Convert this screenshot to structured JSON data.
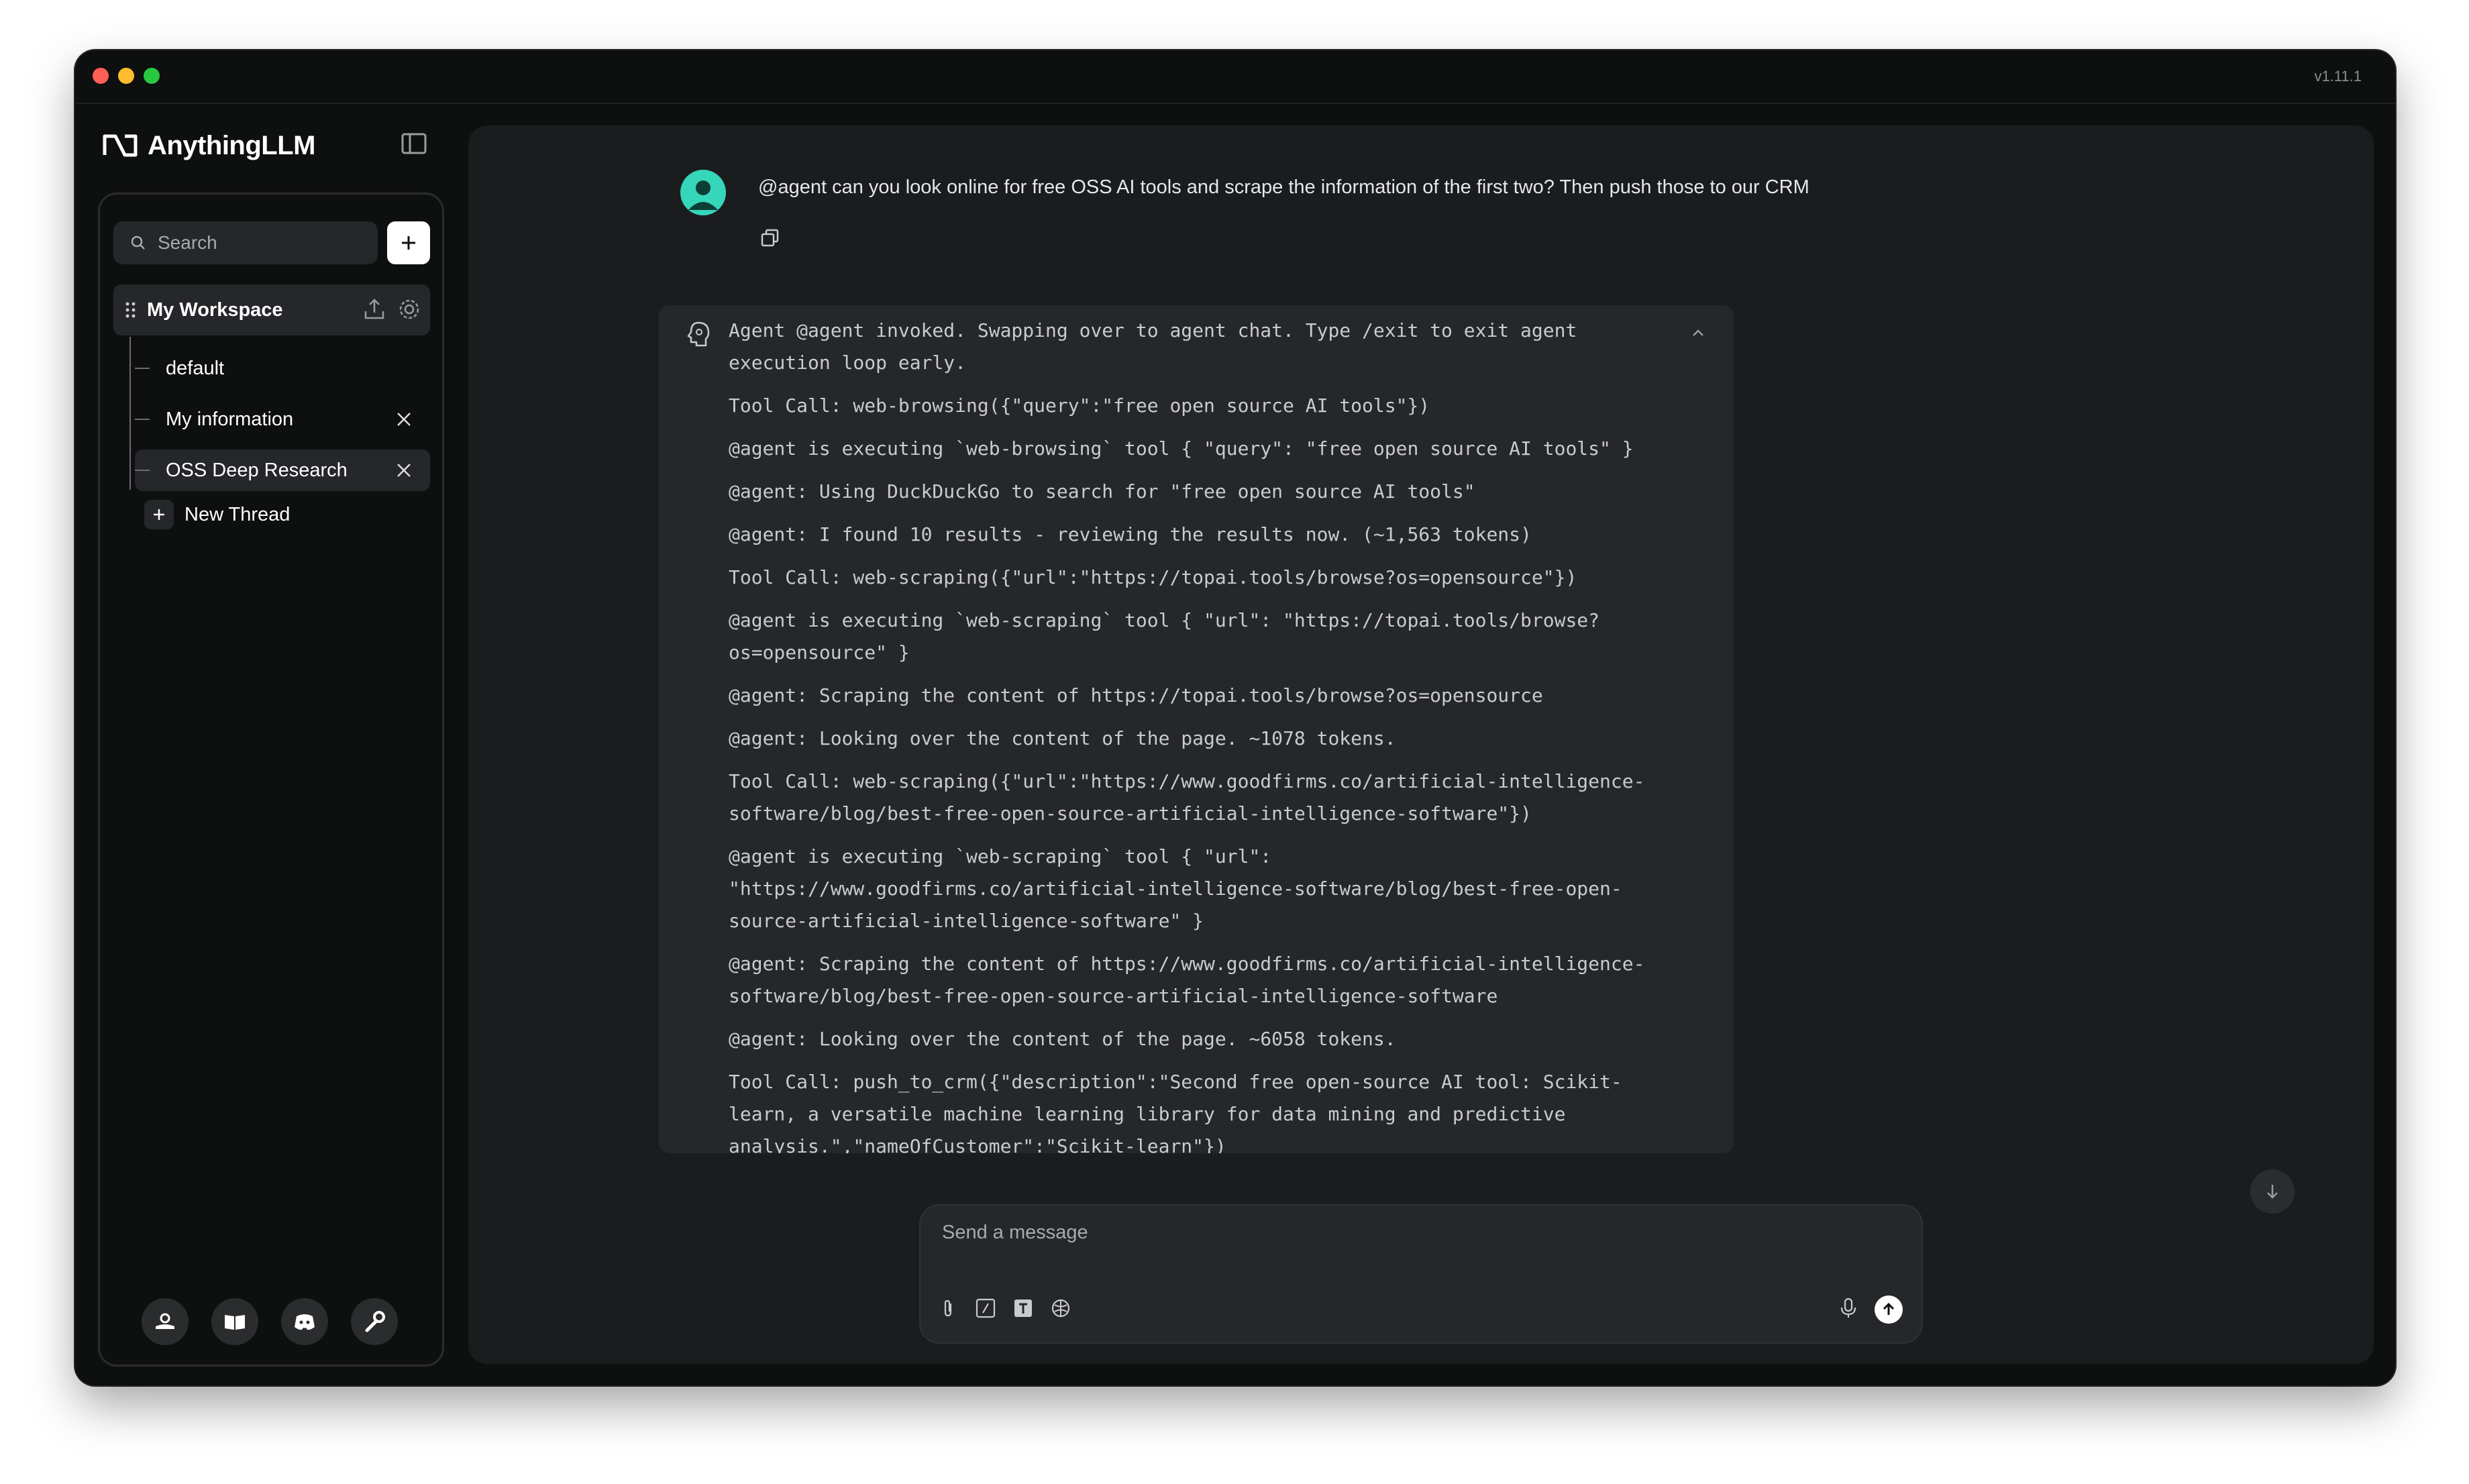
{
  "window": {
    "version": "v1.11.1"
  },
  "brand": {
    "name": "AnythingLLM"
  },
  "sidebar": {
    "search_placeholder": "Search",
    "workspace": {
      "name": "My Workspace"
    },
    "threads": [
      {
        "label": "default",
        "active": false,
        "closable": false
      },
      {
        "label": "My information",
        "active": false,
        "closable": true
      },
      {
        "label": "OSS Deep Research",
        "active": true,
        "closable": true
      }
    ],
    "new_thread_label": "New Thread",
    "footer_icons": [
      "community-hub-icon",
      "docs-book-icon",
      "discord-icon",
      "settings-wrench-icon"
    ]
  },
  "chat": {
    "user_message": "@agent can you look online for free OSS AI tools and scrape the information of the first two? Then push those to our CRM",
    "agent_log": [
      "Agent @agent invoked. Swapping over to agent chat. Type /exit to exit agent execution loop early.",
      "Tool Call: web-browsing({\"query\":\"free open source AI tools\"})",
      "@agent is executing `web-browsing` tool { \"query\": \"free open source AI tools\" }",
      "@agent: Using DuckDuckGo to search for \"free open source AI tools\"",
      "@agent: I found 10 results - reviewing the results now. (~1,563 tokens)",
      "Tool Call: web-scraping({\"url\":\"https://topai.tools/browse?os=opensource\"})",
      "@agent is executing `web-scraping` tool { \"url\": \"https://topai.tools/browse?os=opensource\" }",
      "@agent: Scraping the content of https://topai.tools/browse?os=opensource",
      "@agent: Looking over the content of the page. ~1078 tokens.",
      "Tool Call: web-scraping({\"url\":\"https://www.goodfirms.co/artificial-intelligence-software/blog/best-free-open-source-artificial-intelligence-software\"})",
      "@agent is executing `web-scraping` tool { \"url\": \"https://www.goodfirms.co/artificial-intelligence-software/blog/best-free-open-source-artificial-intelligence-software\" }",
      "@agent: Scraping the content of https://www.goodfirms.co/artificial-intelligence-software/blog/best-free-open-source-artificial-intelligence-software",
      "@agent: Looking over the content of the page. ~6058 tokens.",
      "Tool Call: push_to_crm({\"description\":\"Second free open-source AI tool: Scikit-learn, a versatile machine learning library for data mining and predictive analysis.\",\"nameOfCustomer\":\"Scikit-learn\"})"
    ]
  },
  "composer": {
    "placeholder": "Send a message",
    "tool_icons": [
      "attach-paperclip-icon",
      "slash-command-icon",
      "text-size-icon",
      "agent-brain-icon"
    ]
  },
  "colors": {
    "window_bg": "#0e0f0f",
    "panel_bg": "#1b1c1e",
    "card_bg": "#26272a",
    "avatar_teal": "#35d6ba",
    "text_primary": "#ffffff"
  }
}
